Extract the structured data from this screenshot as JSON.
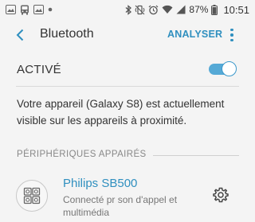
{
  "status_bar": {
    "time": "10:51",
    "battery_level": "87%",
    "icons": [
      "photo-icon",
      "bus-icon",
      "photo-icon",
      "more-notifications-icon",
      "bluetooth-icon",
      "vibrate-icon",
      "alarm-icon",
      "wifi-icon",
      "signal-icon",
      "battery-icon"
    ]
  },
  "appbar": {
    "title": "Bluetooth",
    "action_label": "ANALYSER"
  },
  "toggle": {
    "label": "ACTIVÉ",
    "state": "on",
    "accent": "#3b98cb"
  },
  "info_text": "Votre appareil (Galaxy S8) est actuellement visible sur les appareils à proximité.",
  "paired": {
    "header": "PÉRIPHÉRIQUES APPAIRÉS",
    "devices": [
      {
        "name": "Philips SB500",
        "status": "Connecté pr son d'appel et multimédia",
        "icon": "speaker-device-icon"
      }
    ]
  },
  "colors": {
    "accent": "#2f8fbf",
    "background": "#f4f4f4"
  }
}
